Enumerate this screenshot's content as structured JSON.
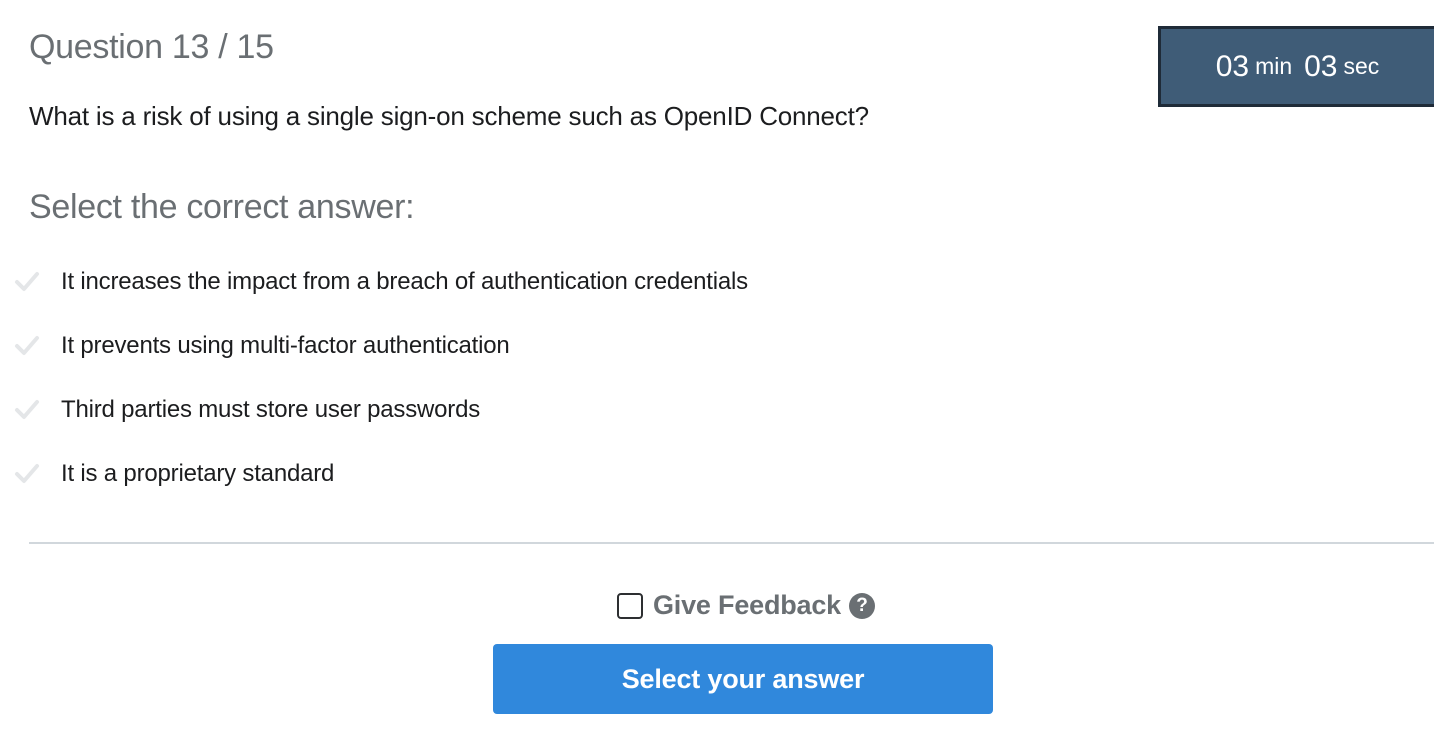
{
  "header": {
    "question_counter": "Question 13 / 15"
  },
  "timer": {
    "minutes": "03",
    "minutes_unit": "min",
    "seconds": "03",
    "seconds_unit": "sec",
    "background_color": "#3f5c77"
  },
  "question": {
    "text": "What is a risk of using a single sign-on scheme such as OpenID Connect?",
    "prompt": "Select the correct answer:"
  },
  "options": [
    {
      "label": "It increases the impact from a breach of authentication credentials",
      "icon": "check-icon"
    },
    {
      "label": "It prevents using multi-factor authentication",
      "icon": "check-icon"
    },
    {
      "label": "Third parties must store user passwords",
      "icon": "check-icon"
    },
    {
      "label": "It is a proprietary standard",
      "icon": "check-icon"
    }
  ],
  "feedback": {
    "label": "Give Feedback",
    "checked": false,
    "help_icon": "question-circle-icon",
    "help_glyph": "?"
  },
  "submit": {
    "label": "Select your answer",
    "color": "#3088dc"
  }
}
